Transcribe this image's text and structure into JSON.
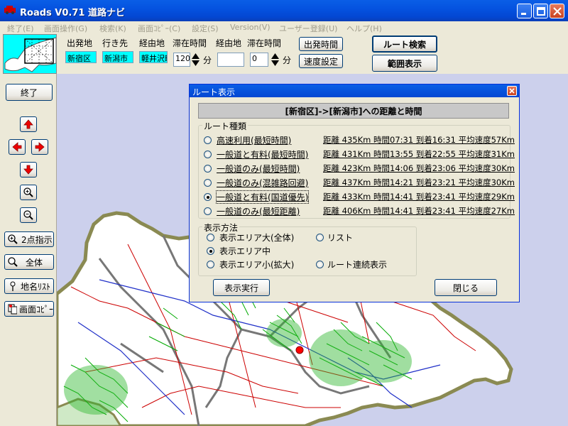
{
  "window": {
    "title": "Roads V0.71 道路ナビ"
  },
  "menu": [
    "終了(E)",
    "画面操作(G)",
    "検索(K)",
    "画面ｺﾋﾟｰ(C)",
    "設定(S)",
    "Version(V)",
    "ユーザー登録(U)",
    "ヘルプ(H)"
  ],
  "top": {
    "labels": {
      "departure": "出発地",
      "destination": "行き先",
      "via1": "経由地",
      "stay1": "滞在時間",
      "via2": "経由地",
      "stay2": "滞在時間",
      "min1": "分",
      "min2": "分"
    },
    "departure": "新宿区",
    "destination": "新潟市",
    "via1": "軽井沢町",
    "stay1": "120",
    "via2": "",
    "stay2": "0",
    "buttons": {
      "depart_time": "出発時間",
      "speed_setting": "速度設定",
      "route_search": "ルート検索",
      "range_display": "範囲表示"
    }
  },
  "toolbar": {
    "exit": "終了",
    "two_point": "2点指示",
    "whole": "全体",
    "place_list": "地名ﾘｽﾄ",
    "screen_copy": "画面ｺﾋﾟｰ"
  },
  "dialog": {
    "title": "ルート表示",
    "header": "[新宿区]->[新潟市]への距離と時間",
    "route_group": "ルート種類",
    "routes": [
      {
        "name": "高速利用(最短時間)",
        "info": "距離 435Km  時間07:31  到着16:31  平均速度57Km",
        "selected": false
      },
      {
        "name": "一般道と有料(最短時間)",
        "info": "距離 431Km  時間13:55  到着22:55  平均速度31Km",
        "selected": false
      },
      {
        "name": "一般道のみ(最短時間)",
        "info": "距離 423Km  時間14:06  到着23:06  平均速度30Km",
        "selected": false
      },
      {
        "name": "一般道のみ(混雑路回避)",
        "info": "距離 437Km  時間14:21  到着23:21  平均速度30Km",
        "selected": false
      },
      {
        "name": "一般道と有料(国道優先)",
        "info": "距離 433Km  時間14:41  到着23:41  平均速度29Km",
        "selected": true
      },
      {
        "name": "一般道のみ(最短距離)",
        "info": "距離 406Km  時間14:41  到着23:41  平均速度27Km",
        "selected": false
      }
    ],
    "display_group": "表示方法",
    "display_options": {
      "large": "表示エリア大(全体)",
      "list": "リスト",
      "medium": "表示エリア中",
      "small": "表示エリア小(拡大)",
      "continuous": "ルート連続表示"
    },
    "display_selected": "medium",
    "buttons": {
      "execute": "表示実行",
      "close": "閉じる"
    }
  },
  "colors": {
    "titlebar": "#0553e0",
    "map_bg": "#ccd0ec",
    "land": "#ffffff",
    "coast": "#8a8a52",
    "route": "#cc0000",
    "road_green": "#00aa00",
    "accent_cyan": "#00ffff"
  }
}
